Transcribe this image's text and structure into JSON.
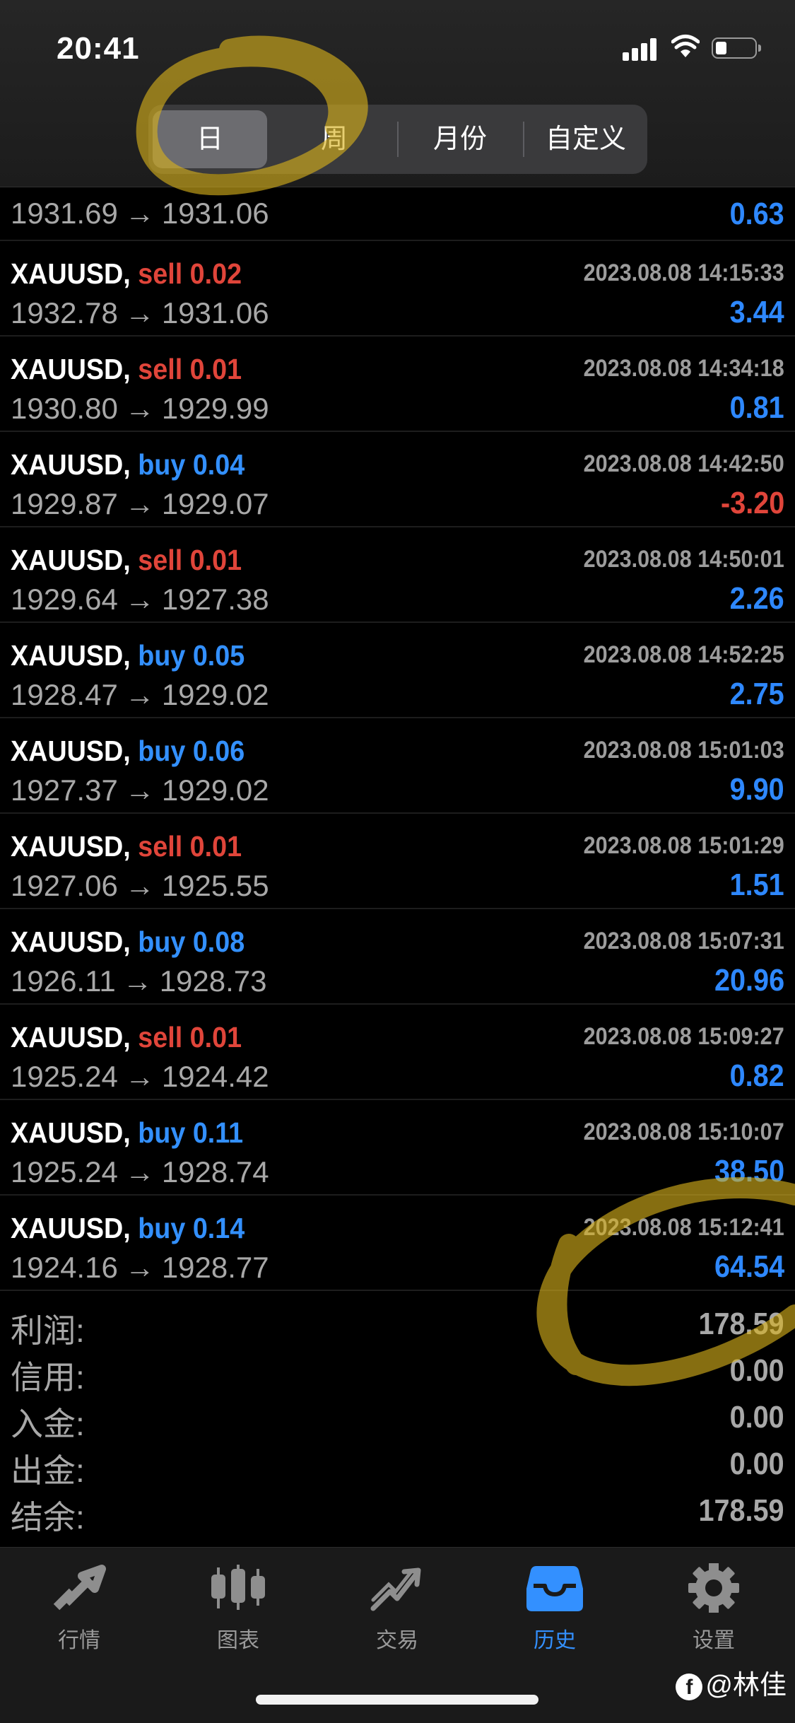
{
  "status_bar": {
    "time": "20:41"
  },
  "period_tabs": [
    "日",
    "周",
    "月份",
    "自定义"
  ],
  "active_period": "日",
  "partial_row": {
    "prices": [
      "1931.69",
      "1931.06"
    ],
    "profit": "0.63"
  },
  "deals": [
    {
      "symbol": "XAUUSD,",
      "side": "sell",
      "volume": "0.02",
      "datetime": "2023.08.08 14:15:33",
      "prices": [
        "1932.78",
        "1931.06"
      ],
      "profit": "3.44"
    },
    {
      "symbol": "XAUUSD,",
      "side": "sell",
      "volume": "0.01",
      "datetime": "2023.08.08 14:34:18",
      "prices": [
        "1930.80",
        "1929.99"
      ],
      "profit": "0.81"
    },
    {
      "symbol": "XAUUSD,",
      "side": "buy",
      "volume": "0.04",
      "datetime": "2023.08.08 14:42:50",
      "prices": [
        "1929.87",
        "1929.07"
      ],
      "profit": "-3.20"
    },
    {
      "symbol": "XAUUSD,",
      "side": "sell",
      "volume": "0.01",
      "datetime": "2023.08.08 14:50:01",
      "prices": [
        "1929.64",
        "1927.38"
      ],
      "profit": "2.26"
    },
    {
      "symbol": "XAUUSD,",
      "side": "buy",
      "volume": "0.05",
      "datetime": "2023.08.08 14:52:25",
      "prices": [
        "1928.47",
        "1929.02"
      ],
      "profit": "2.75"
    },
    {
      "symbol": "XAUUSD,",
      "side": "buy",
      "volume": "0.06",
      "datetime": "2023.08.08 15:01:03",
      "prices": [
        "1927.37",
        "1929.02"
      ],
      "profit": "9.90"
    },
    {
      "symbol": "XAUUSD,",
      "side": "sell",
      "volume": "0.01",
      "datetime": "2023.08.08 15:01:29",
      "prices": [
        "1927.06",
        "1925.55"
      ],
      "profit": "1.51"
    },
    {
      "symbol": "XAUUSD,",
      "side": "buy",
      "volume": "0.08",
      "datetime": "2023.08.08 15:07:31",
      "prices": [
        "1926.11",
        "1928.73"
      ],
      "profit": "20.96"
    },
    {
      "symbol": "XAUUSD,",
      "side": "sell",
      "volume": "0.01",
      "datetime": "2023.08.08 15:09:27",
      "prices": [
        "1925.24",
        "1924.42"
      ],
      "profit": "0.82"
    },
    {
      "symbol": "XAUUSD,",
      "side": "buy",
      "volume": "0.11",
      "datetime": "2023.08.08 15:10:07",
      "prices": [
        "1925.24",
        "1928.74"
      ],
      "profit": "38.50"
    },
    {
      "symbol": "XAUUSD,",
      "side": "buy",
      "volume": "0.14",
      "datetime": "2023.08.08 15:12:41",
      "prices": [
        "1924.16",
        "1928.77"
      ],
      "profit": "64.54"
    }
  ],
  "summary": [
    {
      "label": "利润:",
      "value": "178.59"
    },
    {
      "label": "信用:",
      "value": "0.00"
    },
    {
      "label": "入金:",
      "value": "0.00"
    },
    {
      "label": "出金:",
      "value": "0.00"
    },
    {
      "label": "结余:",
      "value": "178.59"
    }
  ],
  "tabbar": [
    {
      "label": "行情",
      "icon": "quotes-icon"
    },
    {
      "label": "图表",
      "icon": "chart-icon"
    },
    {
      "label": "交易",
      "icon": "trade-icon"
    },
    {
      "label": "历史",
      "icon": "history-icon"
    },
    {
      "label": "设置",
      "icon": "settings-icon"
    }
  ],
  "active_tab": "历史",
  "watermark": {
    "text": "@林佳"
  },
  "colors": {
    "sell": "#e0453a",
    "buy": "#3390ff",
    "profit_positive": "#2e88ff",
    "profit_negative": "#e0453a",
    "annotation": "#d8b21c"
  }
}
